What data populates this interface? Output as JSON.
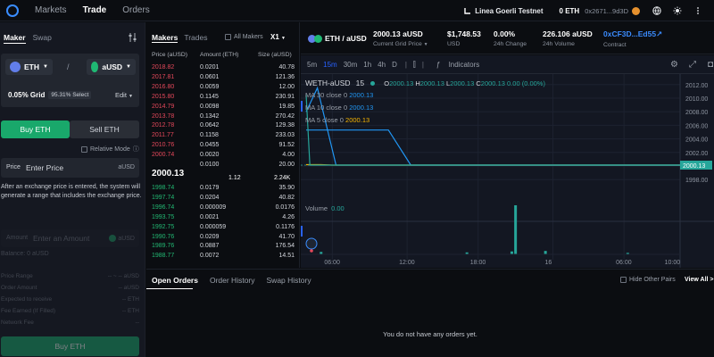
{
  "nav": {
    "links": [
      "Markets",
      "Trade",
      "Orders"
    ],
    "network": "Linea Goerli Testnet",
    "eth_balance": "0 ETH",
    "address": "0x2671...9d3D"
  },
  "left": {
    "mode_tabs": [
      "Maker",
      "Swap"
    ],
    "base_token": "ETH",
    "quote_token": "aUSD",
    "separator": "/",
    "grid_label": "0.05% Grid",
    "grid_badge": "95.31% Select",
    "edit_label": "Edit",
    "buy_tab": "Buy ETH",
    "sell_tab": "Sell ETH",
    "relative_mode": "Relative Mode",
    "price_label": "Price",
    "price_placeholder": "Enter Price",
    "price_unit": "aUSD",
    "info_text": "After an exchange price is entered, the system will generate a range that includes the exchange price.",
    "amount_label": "Amount",
    "amount_placeholder": "Enter an Amount",
    "amount_unit": "aUSD",
    "balance": "Balance: 0 aUSD",
    "rows": [
      {
        "k": "Price Range",
        "v": "-- ~ -- aUSD"
      },
      {
        "k": "Order Amount",
        "v": "-- aUSD"
      },
      {
        "k": "Expected to receive",
        "v": "-- ETH"
      },
      {
        "k": "Fee Earned (If Filled)",
        "v": "-- ETH"
      },
      {
        "k": "Network Fee",
        "v": "--"
      }
    ],
    "submit": "Buy ETH"
  },
  "book": {
    "tabs": [
      "Makers",
      "Trades"
    ],
    "all_makers": "All Makers",
    "multiplier": "X1",
    "headers": [
      "Price (aUSD)",
      "Amount (ETH)",
      "Size (aUSD)"
    ],
    "asks": [
      [
        "2018.82",
        "0.0201",
        "40.78"
      ],
      [
        "2017.81",
        "0.0601",
        "121.36"
      ],
      [
        "2016.80",
        "0.0059",
        "12.00"
      ],
      [
        "2015.80",
        "0.1145",
        "230.91"
      ],
      [
        "2014.79",
        "0.0098",
        "19.85"
      ],
      [
        "2013.78",
        "0.1342",
        "270.42"
      ],
      [
        "2012.78",
        "0.0642",
        "129.38"
      ],
      [
        "2011.77",
        "0.1158",
        "233.03"
      ],
      [
        "2010.76",
        "0.0455",
        "91.52"
      ],
      [
        "2000.74",
        "0.0020",
        "4.00"
      ],
      [
        "",
        "0.0100",
        "20.00"
      ]
    ],
    "mid_price": "2000.13",
    "mid_amount": "1.12",
    "mid_size": "2.24K",
    "bids": [
      [
        "1998.74",
        "0.0179",
        "35.90"
      ],
      [
        "1997.74",
        "0.0204",
        "40.82"
      ],
      [
        "1996.74",
        "0.000009",
        "0.0176"
      ],
      [
        "1993.75",
        "0.0021",
        "4.26"
      ],
      [
        "1992.75",
        "0.000059",
        "0.1176"
      ],
      [
        "1990.76",
        "0.0209",
        "41.70"
      ],
      [
        "1989.76",
        "0.0887",
        "176.54"
      ],
      [
        "1988.77",
        "0.0072",
        "14.51"
      ]
    ]
  },
  "market": {
    "pair": "ETH / aUSD",
    "grid_price": "2000.13 aUSD",
    "grid_price_label": "Current Grid Price",
    "usd": "$1,748.53",
    "usd_label": "USD",
    "change": "0.00%",
    "change_label": "24h Change",
    "volume": "226.106 aUSD",
    "volume_label": "24h Volume",
    "contract": "0xCF3D...Ed55",
    "contract_label": "Contract"
  },
  "chart_tools": {
    "intervals": [
      "5m",
      "15m",
      "30m",
      "1h",
      "4h",
      "D"
    ],
    "indicators": "Indicators"
  },
  "chart_legend": {
    "symbol": "WETH-aUSD",
    "interval": "15",
    "o_label": "O",
    "o": "2000.13",
    "h_label": "H",
    "h": "2000.13",
    "l_label": "L",
    "l": "2000.13",
    "c_label": "C",
    "c": "2000.13",
    "chg": "0.00 (0.00%)",
    "ma30_label": "MA 30 close 0",
    "ma30": "2000.13",
    "ma10_label": "MA 10 close 0",
    "ma10": "2000.13",
    "ma5_label": "MA 5 close 0",
    "ma5": "2000.13",
    "volume_label": "Volume",
    "volume_value": "0.00",
    "last_price": "2000.13"
  },
  "chart_data": {
    "type": "line",
    "title": "WETH-aUSD",
    "price_axis": [
      "2012.00",
      "2010.00",
      "2008.00",
      "2006.00",
      "2004.00",
      "2002.00",
      "2000.00",
      "1998.00"
    ],
    "time_axis": [
      "06:00",
      "12:00",
      "18:00",
      "16",
      "06:00",
      "10:00"
    ],
    "ylim": [
      1997.5,
      2012.5
    ],
    "series": [
      {
        "name": "MA 30 close 0",
        "color": "#2196f3",
        "points": [
          [
            0,
            2005.3
          ],
          [
            0.05,
            2005.3
          ],
          [
            0.22,
            2005.3
          ],
          [
            0.28,
            2000.13
          ],
          [
            1,
            2000.13
          ]
        ]
      },
      {
        "name": "MA 10 close 0",
        "color": "#2196f3",
        "points": [
          [
            0,
            2008.0
          ],
          [
            0.03,
            2011.5
          ],
          [
            0.08,
            2000.13
          ],
          [
            1,
            2000.13
          ]
        ]
      },
      {
        "name": "MA 5 close 0",
        "color": "#f7b500",
        "points": [
          [
            0,
            2000.2
          ],
          [
            0.04,
            2000.2
          ],
          [
            0.07,
            2000.13
          ],
          [
            1,
            2000.13
          ]
        ]
      },
      {
        "name": "WETH-aUSD",
        "color": "#26a69a",
        "points": [
          [
            0,
            2010.5
          ],
          [
            0.01,
            2000.13
          ],
          [
            1,
            2000.13
          ]
        ]
      }
    ],
    "volume_bars": [
      {
        "x": 0.04,
        "v": 0.05
      },
      {
        "x": 0.43,
        "v": 0.04
      },
      {
        "x": 0.55,
        "v": 0.06
      },
      {
        "x": 0.56,
        "v": 1.0
      },
      {
        "x": 0.64,
        "v": 0.07
      },
      {
        "x": 0.86,
        "v": 0.03
      }
    ]
  },
  "orders": {
    "tabs": [
      "Open Orders",
      "Order History",
      "Swap History"
    ],
    "hide_pairs": "Hide Other Pairs",
    "view_all": "View All >",
    "empty": "You do not have any orders yet."
  }
}
